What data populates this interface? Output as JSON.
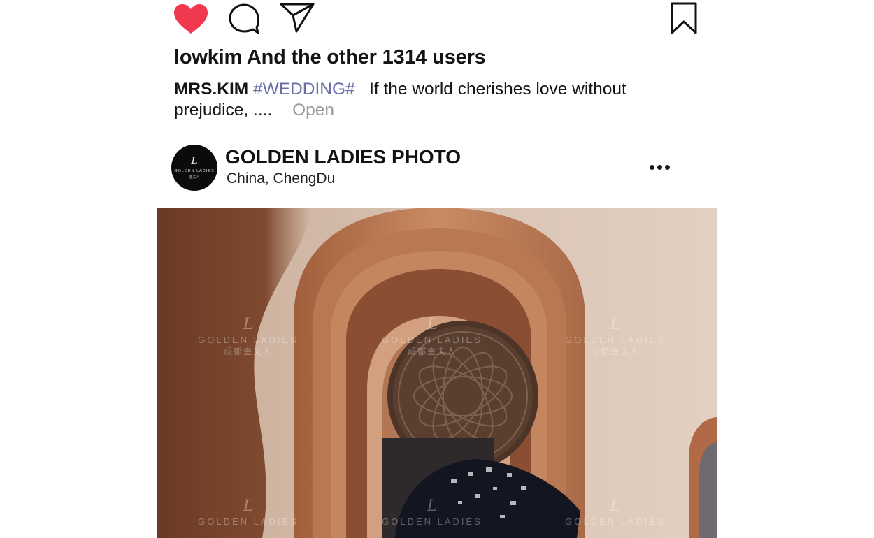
{
  "post": {
    "actions": {
      "like": {
        "icon": "heart-icon",
        "liked": true,
        "color": "#f0394f"
      },
      "comment": {
        "icon": "comment-icon"
      },
      "share": {
        "icon": "send-icon"
      },
      "save": {
        "icon": "bookmark-icon"
      }
    },
    "likes_text": "lowkim And the other 1314 users",
    "caption": {
      "author": "MRS.KIM",
      "hashtag": "#WEDDING#",
      "text": "If the world cherishes love without prejudice, ....",
      "more_label": "Open"
    },
    "account": {
      "name": "GOLDEN LADIES PHOTO",
      "location_country": "China,",
      "location_city": "ChengDu",
      "avatar": {
        "monogram": "L",
        "brand": "GOLDEN LADIES",
        "chinese": "金夫人"
      },
      "more_icon": "more-dots-icon"
    },
    "photo": {
      "watermark": {
        "monogram": "L",
        "brand": "GOLDEN LADIES",
        "chinese": "成都金夫人"
      }
    }
  }
}
